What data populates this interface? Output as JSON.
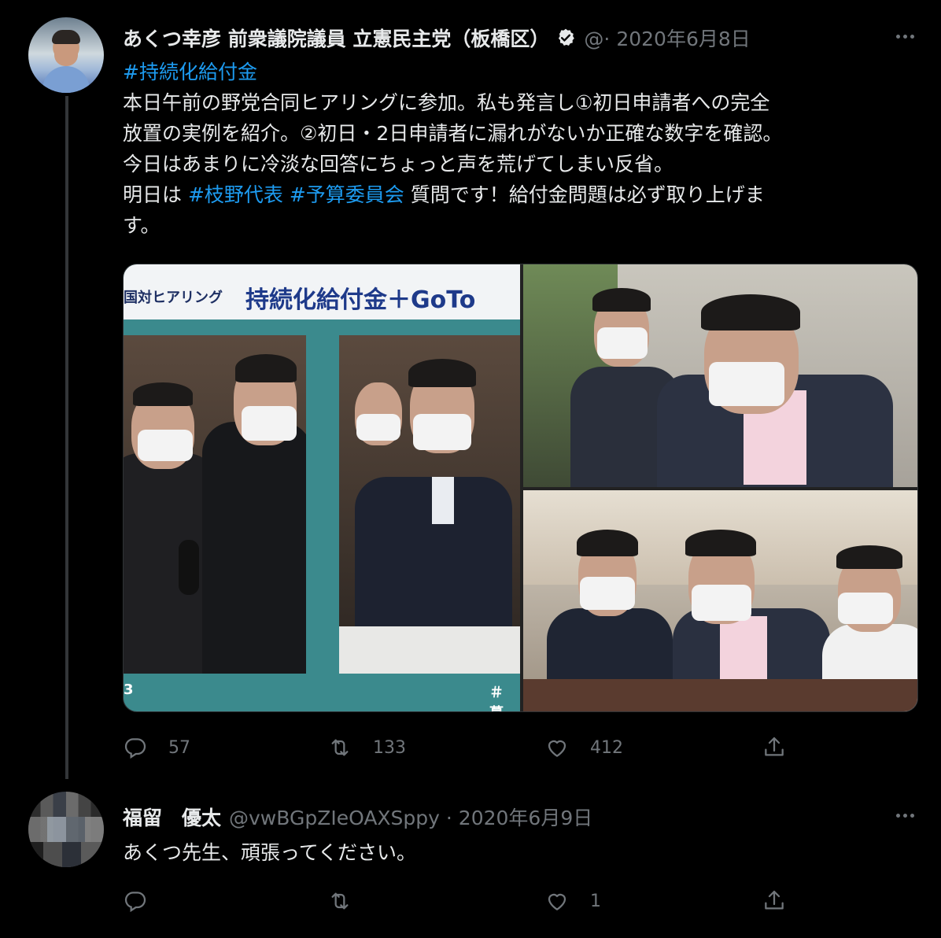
{
  "tweet": {
    "author_name": "あくつ幸彦 前衆議院議員 立憲民主党（板橋区）",
    "handle_date": "@· 2020年6月8日",
    "lines": [
      {
        "parts": [
          {
            "t": "#持続化給付金",
            "tag": true
          }
        ]
      },
      {
        "parts": [
          {
            "t": "本日午前の野党合同ヒアリングに参加。私も発言し①初日申請者への完全",
            "tag": false
          }
        ]
      },
      {
        "parts": [
          {
            "t": "放置の実例を紹介。②初日・2日申請者に漏れがないか正確な数字を確認。",
            "tag": false
          }
        ]
      },
      {
        "parts": [
          {
            "t": "今日はあまりに冷淡な回答にちょっと声を荒げてしまい反省。",
            "tag": false
          }
        ]
      },
      {
        "parts": [
          {
            "t": "明日は ",
            "tag": false
          },
          {
            "t": "#枝野代表",
            "tag": true
          },
          {
            "t": " ",
            "tag": false
          },
          {
            "t": "#予算委員会",
            "tag": true
          },
          {
            "t": " 質問です！給付金問題は必ず取り上げま",
            "tag": false
          }
        ]
      },
      {
        "parts": [
          {
            "t": "す。",
            "tag": false
          }
        ]
      }
    ],
    "media": {
      "banner_small": "国対ヒアリング",
      "banner_big": "持続化給付金＋GoTo",
      "footer_right": "＃ 暮",
      "footer_left": "3"
    },
    "actions": {
      "replies": "57",
      "retweets": "133",
      "likes": "412"
    }
  },
  "reply": {
    "author_name": "福留　優太",
    "handle_date": "@vwBGpZIeOAXSppy · 2020年6月9日",
    "text": "あくつ先生、頑張ってください。",
    "actions": {
      "replies": "",
      "retweets": "",
      "likes": "1"
    }
  },
  "icons": [
    "reply-icon",
    "retweet-icon",
    "like-icon",
    "share-icon",
    "verified-icon",
    "more-icon"
  ],
  "colors": {
    "background": "#000000",
    "text": "#e7e9ea",
    "muted": "#71767b",
    "link": "#1d9bf0"
  }
}
